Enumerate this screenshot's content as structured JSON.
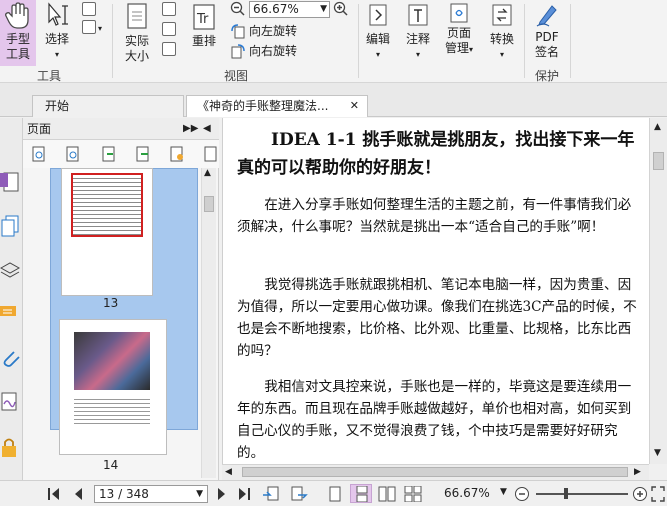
{
  "ribbon": {
    "hand_tool": {
      "line1": "手型",
      "line2": "工具"
    },
    "select": {
      "label": "选择"
    },
    "tools_group": "工具",
    "actual_size": {
      "line1": "实际",
      "line2": "大小"
    },
    "reflow": "重排",
    "zoom_value": "66.67%",
    "rotate_left": "向左旋转",
    "rotate_right": "向右旋转",
    "view_group": "视图",
    "edit": "编辑",
    "annotate": "注释",
    "page_manage": {
      "line1": "页面",
      "line2": "管理"
    },
    "convert": "转换",
    "pdf_sign": {
      "line1": "PDF",
      "line2": "签名"
    },
    "protect_group": "保护",
    "accent": "#e4c6ec"
  },
  "tabs": [
    {
      "label": "开始"
    },
    {
      "label": "《神奇的手账整理魔法...",
      "close": "✕"
    }
  ],
  "panel": {
    "title": "页面",
    "thumbs": [
      {
        "page": "13"
      },
      {
        "page": "14"
      }
    ]
  },
  "document": {
    "title": "IDEA 1-1 挑手账就是挑朋友，找出接下来一年真的可以帮助你的好朋友！",
    "paragraphs": [
      "在进入分享手账如何整理生活的主题之前，有一件事情我们必须解决，什么事呢？当然就是挑出一本“适合自己的手账”啊！",
      "我觉得挑选手账就跟挑相机、笔记本电脑一样，因为贵重、因为值得，所以一定要用心做功课。像我们在挑选3C产品的时候，不也是会不断地搜索，比价格、比外观、比重量、比规格，比东比西的吗？",
      "我相信对文具控来说，手账也是一样的，毕竟这是要连续用一年的东西。而且现在品牌手账越做越好，单价也相对高，如何买到自己心仪的手账，又不觉得浪费了钱，个中技巧是需要好好研究的。"
    ]
  },
  "status": {
    "page_input": "13 / 348",
    "zoom": "66.67%"
  }
}
